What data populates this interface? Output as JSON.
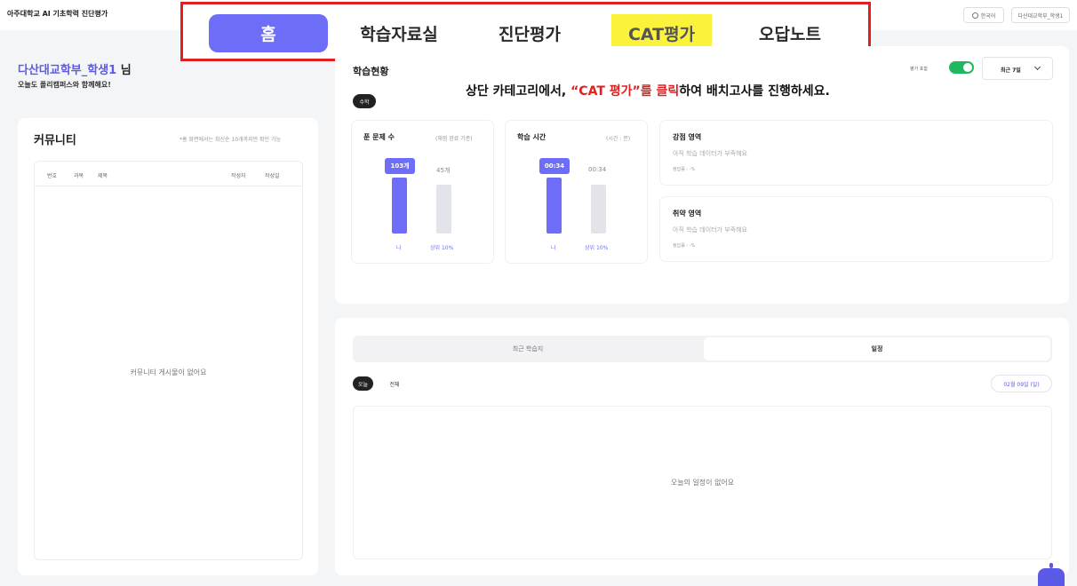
{
  "header": {
    "brand": "아주대학교 AI 기초학력 진단평가",
    "language_label": "한국어",
    "user_label": "다산대교학부_학생1"
  },
  "nav": {
    "items": [
      "홈",
      "학습자료실",
      "진단평가",
      "CAT평가",
      "오답노트"
    ],
    "active": "홈",
    "highlighted": "CAT평가"
  },
  "welcome": {
    "name": "다산대교학부_학생1",
    "suffix": " 님",
    "message": "오늘도 폴리캠퍼스와 함께해요!"
  },
  "community": {
    "title": "커뮤니티",
    "note": "*홈 화면에서는 최신순 10개까지만 확인 가능",
    "columns": [
      "번호",
      "과목",
      "제목",
      "작성자",
      "작성일"
    ],
    "empty_message": "커뮤니티 게시물이 없어요"
  },
  "study": {
    "title": "학습현황",
    "subject": "수학",
    "toggle_label": "평가 포함",
    "toggle_on": true,
    "period": "최근 7일",
    "solved": {
      "title": "푼 문제 수",
      "note": "(채점 완료 기준)",
      "me_value": "103개",
      "top_value": "45개",
      "me_label": "나",
      "top_label": "상위 10%"
    },
    "time": {
      "title": "학습 시간",
      "note": "(시간 : 분)",
      "me_value": "00:34",
      "top_value": "00:34",
      "me_label": "나",
      "top_label": "상위 10%"
    },
    "strength": {
      "title": "강점 영역",
      "message": "아직 학습 데이터가 부족해요",
      "rate": "정답률 : -%"
    },
    "weakness": {
      "title": "취약 영역",
      "message": "아직 학습 데이터가 부족해요",
      "rate": "정답률 : -%"
    }
  },
  "instruction": {
    "before": "상단 카테고리에서, ",
    "highlight": "“CAT 평가”를 클릭",
    "after": "하여 배치고사를 진행하세요."
  },
  "schedule": {
    "tabs": [
      "최근 학습지",
      "일정"
    ],
    "active_tab": "일정",
    "chips": [
      "오늘",
      "전체"
    ],
    "date": "02월 09일 (일)",
    "empty_message": "오늘의 일정이 없어요"
  },
  "colors": {
    "accent": "#6d6df7",
    "highlight_yellow": "#fbf33b",
    "callout_red": "#e02020",
    "toggle_green": "#20b85e"
  }
}
